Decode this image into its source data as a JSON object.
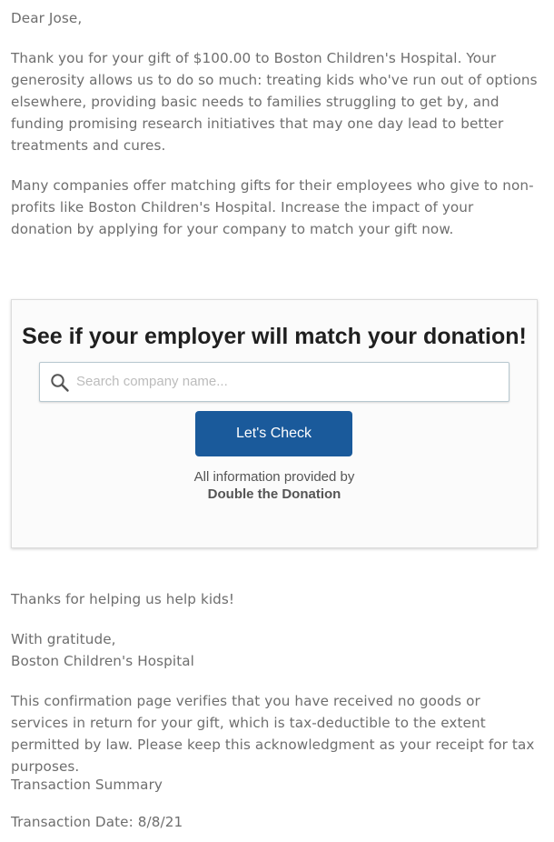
{
  "letter": {
    "greeting": "Dear Jose,",
    "thank_you": "Thank you for your gift of $100.00 to Boston Children's Hospital. Your generosity allows us to do so much: treating kids who've run out of options elsewhere, providing basic needs to families struggling to get by, and funding promising research initiatives that may one day lead to better treatments and cures.",
    "matching_intro": "Many companies offer matching gifts for their employees who give to non-profits like Boston Children's Hospital. Increase the impact of your donation by applying for your company to match your gift now.",
    "thanks_line": "Thanks for helping us help kids!",
    "closing": "With gratitude,",
    "signature": "Boston Children's Hospital",
    "tax_note": "This confirmation page verifies that you have received no goods or services in return for your gift, which is tax-deductible to the extent permitted by law. Please keep this acknowledgment as your receipt for tax purposes.",
    "summary_heading": "Transaction Summary",
    "transaction_date": "Transaction Date: 8/8/21"
  },
  "match_widget": {
    "title": "See if your employer will match your donation!",
    "search_placeholder": "Search company name...",
    "search_icon": "search-icon",
    "button_label": "Let's Check",
    "credit_line1": "All information provided by",
    "credit_line2": "Double the Donation",
    "button_color": "#1a5a9b"
  }
}
